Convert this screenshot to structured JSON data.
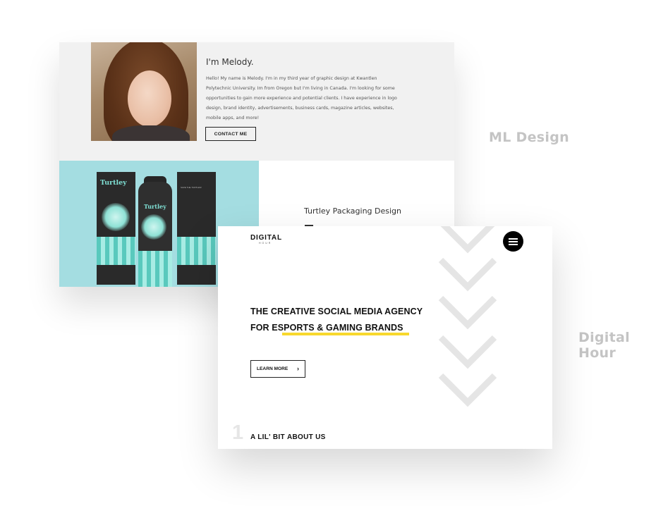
{
  "labels": {
    "ml_design": "ML Design",
    "digital_hour": "Digital Hour"
  },
  "ml_card": {
    "heading": "I'm Melody.",
    "bio": "Hello! My name is Melody. I'm in my third year of graphic design at Kwantlen Polytechnic University. Im from Oregon but I'm living in Canada. I'm looking for some opportunities to gain more experience and potential clients. I have experience in logo design, brand identity, advertisements, business cards, magazine articles, websites, mobile apps, and more!",
    "contact_button": "CONTACT ME",
    "project_title": "Turtley Packaging Design",
    "product_brand": "Turtley",
    "box_text": "SAVE THE TURTLES!"
  },
  "dh_card": {
    "logo": "DIGITAL",
    "logo_sub": "HOUR",
    "hero_line1": "THE CREATIVE SOCIAL MEDIA AGENCY",
    "hero_line2_prefix": "FOR E",
    "hero_line2_highlight": "SPORTS & GAMING BRANDS",
    "learn_more": "LEARN MORE",
    "about_number": "1",
    "about_prefix": "A LIL' BIT ",
    "about_highlight": "ABOUT US",
    "colors": {
      "accent": "#f7d82d",
      "chevron": "#e5e5e5",
      "text": "#111111"
    }
  },
  "icons": [
    "hamburger-menu-icon",
    "chevron-right-icon",
    "chevron-down-icon"
  ]
}
